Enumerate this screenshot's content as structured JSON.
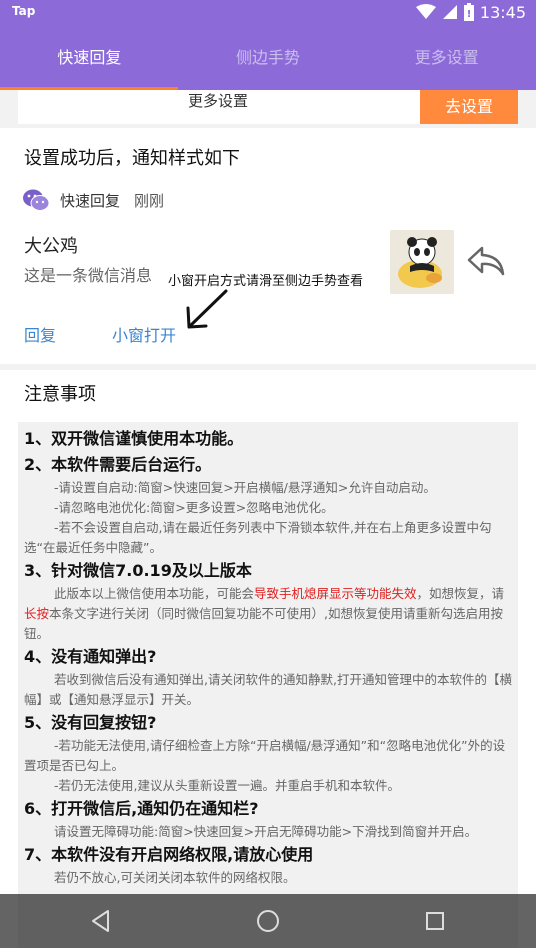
{
  "status_bar": {
    "app_label": "Tap",
    "time": "13:45"
  },
  "tabs": [
    {
      "label": "快速回复"
    },
    {
      "label": "侧边手势"
    },
    {
      "label": "更多设置"
    }
  ],
  "colors": {
    "header": "#8c6bd9",
    "accent": "#ff8a3d",
    "link": "#3a86d0",
    "warn": "#e02020"
  },
  "top_strip": {
    "label": "更多设置",
    "button": "去设置"
  },
  "preview": {
    "title": "设置成功后，通知样式如下",
    "app_name": "快速回复",
    "time": "刚刚",
    "sender": "大公鸡",
    "message": "这是一条微信消息",
    "annotation": "小窗开启方式请滑至侧边手势查看",
    "reply_action": "回复",
    "window_action": "小窗打开"
  },
  "notes": {
    "title": "注意事项",
    "n1": "1、双开微信谨慎使用本功能。",
    "n2": "2、本软件需要后台运行。",
    "n2a": "-请设置自启动:简窗>快速回复>开启横幅/悬浮通知>允许自动启动。",
    "n2b": "-请忽略电池优化:简窗>更多设置>忽略电池优化。",
    "n2c": "-若不会设置自启动,请在最近任务列表中下滑锁本软件,并在右上角更多设置中勾选“在最近任务中隐藏”。",
    "n3": "3、针对微信7.0.19及以上版本",
    "n3a_1": "此版本以上微信使用本功能，可能会",
    "n3a_red": "导致手机熄屏显示等功能失效",
    "n3a_2": "，如想恢复，请",
    "n3a_red2": "长按",
    "n3a_3": "本条文字进行关闭（同时微信回复功能不可使用）,如想恢复使用请重新勾选启用按钮。",
    "n4": "4、没有通知弹出?",
    "n4a": "若收到微信后没有通知弹出,请关闭软件的通知静默,打开通知管理中的本软件的【横幅】或【通知悬浮显示】开关。",
    "n5": "5、没有回复按钮?",
    "n5a": "-若功能无法使用,请仔细检查上方除“开启横幅/悬浮通知”和“忽略电池优化”外的设置项是否已勾上。",
    "n5b": "-若仍无法使用,建议从头重新设置一遍。并重启手机和本软件。",
    "n6": "6、打开微信后,通知仍在通知栏?",
    "n6a": "请设置无障碍功能:简窗>快速回复>开启无障碍功能>下滑找到简窗并开启。",
    "n7": "7、本软件没有开启网络权限,请放心使用",
    "n7a": "若仍不放心,可关闭关闭本软件的网络权限。"
  }
}
